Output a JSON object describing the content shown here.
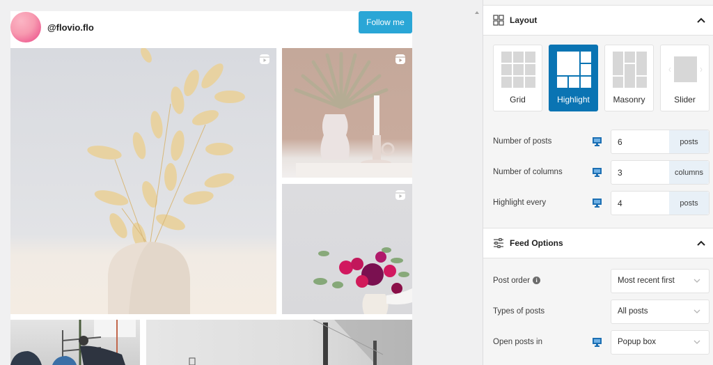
{
  "feed": {
    "username": "@flovio.flo",
    "follow_label": "Follow me",
    "accent_color": "#2aa6d6",
    "posts": [
      {
        "id": 1,
        "type": "reel",
        "subject": "dried bunny tail grass in ceramic vase",
        "highlighted": true
      },
      {
        "id": 2,
        "type": "reel",
        "subject": "dried palm leaf in wavy vase with candle"
      },
      {
        "id": 3,
        "type": "reel",
        "subject": "flower bouquet in white vase"
      },
      {
        "id": 4,
        "type": "image",
        "subject": "people in workshop"
      },
      {
        "id": 5,
        "type": "image",
        "subject": "grey industrial interior"
      }
    ]
  },
  "panel": {
    "layout_section": {
      "title": "Layout",
      "icon": "layout-grid-icon",
      "expanded": true,
      "options": [
        {
          "label": "Grid",
          "selected": false
        },
        {
          "label": "Highlight",
          "selected": true
        },
        {
          "label": "Masonry",
          "selected": false
        },
        {
          "label": "Slider",
          "selected": false
        }
      ],
      "fields": [
        {
          "label": "Number of posts",
          "value": "6",
          "unit": "posts",
          "device_icon": "desktop-icon"
        },
        {
          "label": "Number of columns",
          "value": "3",
          "unit": "columns",
          "device_icon": "desktop-icon"
        },
        {
          "label": "Highlight every",
          "value": "4",
          "unit": "posts",
          "device_icon": "desktop-icon"
        }
      ]
    },
    "feed_options_section": {
      "title": "Feed Options",
      "icon": "sliders-icon",
      "expanded": true,
      "fields": [
        {
          "label": "Post order",
          "value": "Most recent first",
          "has_info": true,
          "info_glyph": "i"
        },
        {
          "label": "Types of posts",
          "value": "All posts"
        },
        {
          "label": "Open posts in",
          "value": "Popup box",
          "device_icon": "desktop-icon"
        }
      ]
    },
    "selected_color": "#0a74b3"
  }
}
